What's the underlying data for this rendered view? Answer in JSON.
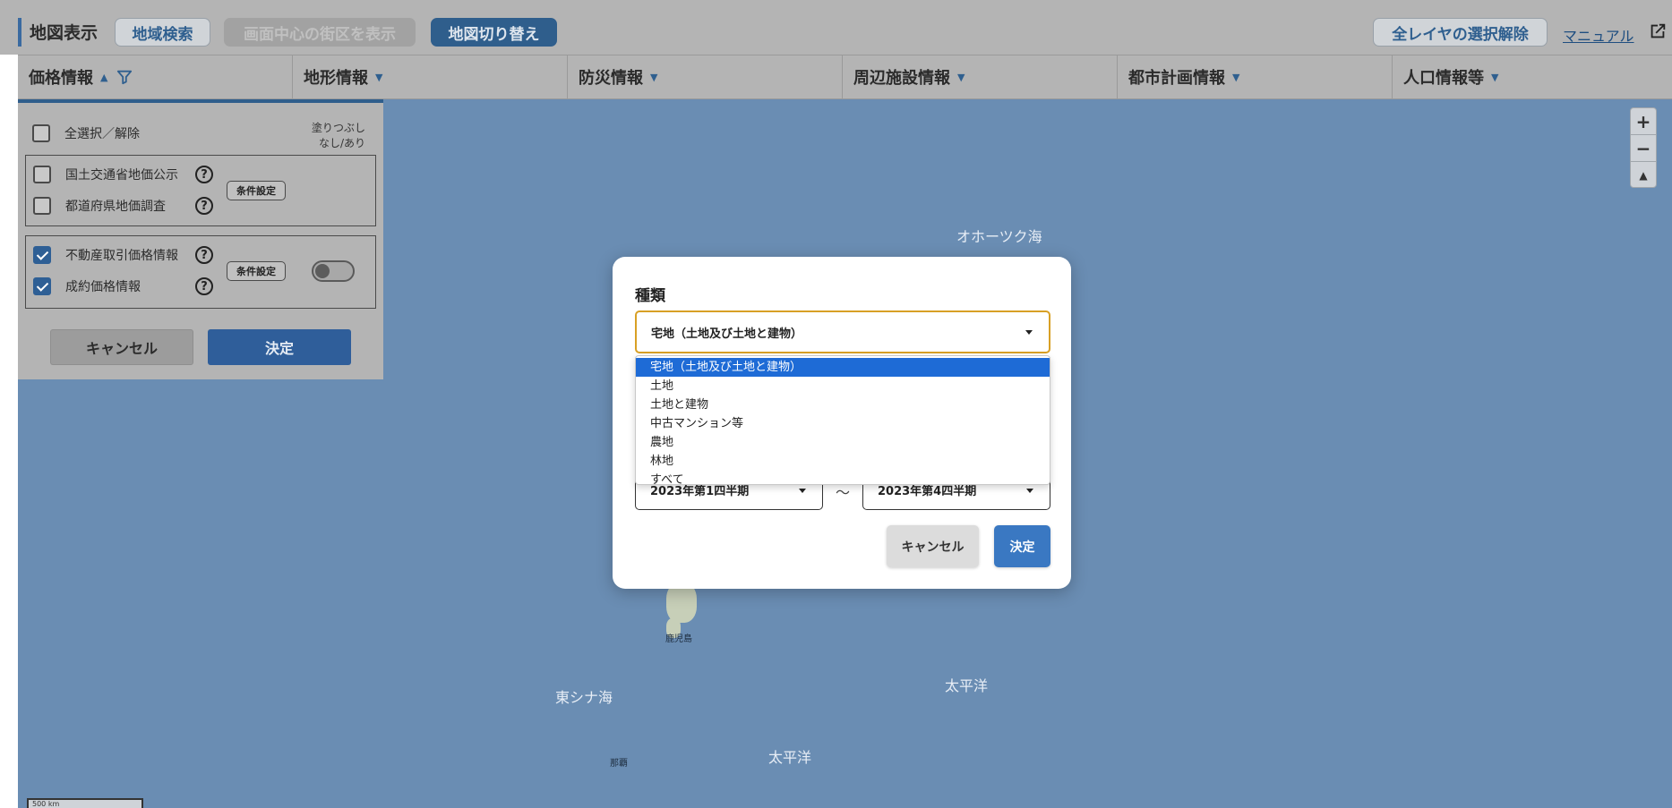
{
  "header": {
    "title": "地図表示",
    "buttons": {
      "region_search": "地域検索",
      "show_center_block": "画面中心の街区を表示",
      "map_switch": "地図切り替え",
      "clear_all_layers": "全レイヤの選択解除"
    },
    "manual_link": "マニュアル"
  },
  "tabs": [
    {
      "label": "価格情報"
    },
    {
      "label": "地形情報"
    },
    {
      "label": "防災情報"
    },
    {
      "label": "周辺施設情報"
    },
    {
      "label": "都市計画情報"
    },
    {
      "label": "人口情報等"
    }
  ],
  "price_panel": {
    "select_all": "全選択／解除",
    "fill_label_line1": "塗りつぶし",
    "fill_label_line2": "なし/あり",
    "group1": {
      "items": [
        {
          "label": "国土交通省地価公示",
          "checked": false
        },
        {
          "label": "都道府県地価調査",
          "checked": false
        }
      ],
      "condition_button": "条件設定"
    },
    "group2": {
      "items": [
        {
          "label": "不動産取引価格情報",
          "checked": true
        },
        {
          "label": "成約価格情報",
          "checked": true
        }
      ],
      "condition_button": "条件設定",
      "fill_toggle": false
    },
    "cancel": "キャンセル",
    "ok": "決定"
  },
  "map": {
    "labels": {
      "okhotsk": "オホーツク海",
      "east_china_sea": "東シナ海",
      "pacific1": "太平洋",
      "pacific2": "太平洋",
      "kagoshima": "鹿児島",
      "naha": "那覇"
    },
    "zoom": {
      "in": "+",
      "out": "−",
      "north": "▲"
    },
    "scale": "500 km"
  },
  "modal": {
    "title": "種類",
    "selected": "宅地（土地及び土地と建物）",
    "options": [
      "宅地（土地及び土地と建物）",
      "土地",
      "土地と建物",
      "中古マンション等",
      "農地",
      "林地",
      "すべて"
    ],
    "period_from": "2023年第1四半期",
    "period_to": "2023年第4四半期",
    "tilde": "～",
    "cancel": "キャンセル",
    "ok": "決定"
  },
  "colors": {
    "accent": "#2f5e8c",
    "map_sea": "#6a8db3",
    "select_border": "#d8a025",
    "option_highlight": "#1e6bd6"
  }
}
